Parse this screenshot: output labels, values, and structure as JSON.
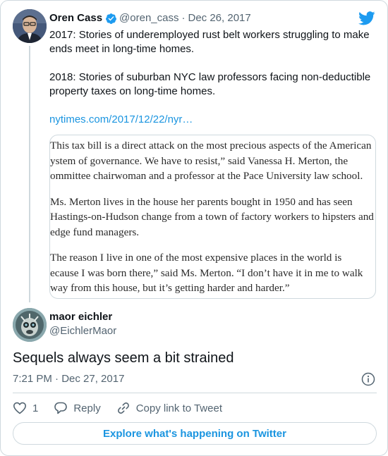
{
  "colors": {
    "link": "#1b95e0",
    "text": "#0f1419",
    "muted": "#536471",
    "border": "#cfd9de",
    "verified": "#1d9bf0"
  },
  "parent_tweet": {
    "author_name": "Oren Cass",
    "handle": "@oren_cass",
    "separator": "·",
    "date": "Dec 26, 2017",
    "paragraphs": [
      "2017: Stories of underemployed rust belt workers struggling to make ends meet in long-time homes.",
      "2018: Stories of suburban NYC law professors facing non-deductible property taxes on long-time homes."
    ],
    "link": "nytimes.com/2017/12/22/nyr…",
    "quote_image": {
      "paragraphs": [
        [
          "This tax bill is a direct attack on the most precious aspects of the American",
          "ystem of governance. We have to resist,” said Vanessa H. Merton, the",
          "ommittee chairwoman and a professor at the Pace University law school."
        ],
        [
          "Ms. Merton lives in the house her parents bought in 1950 and has seen",
          "Hastings-on-Hudson change from a town of factory workers to hipsters and",
          "edge fund managers."
        ],
        [
          "The reason I live in one of the most expensive places in the world is",
          "ecause I was born there,” said Ms. Merton. “I don’t have it in me to walk",
          "way from this house, but it’s getting harder and harder.”"
        ]
      ]
    }
  },
  "reply_tweet": {
    "author_name": "maor eichler",
    "handle": "@EichlerMaor",
    "text": "Sequels always seem a bit strained",
    "timestamp": "7:21 PM · Dec 27, 2017"
  },
  "actions": {
    "like_count": "1",
    "reply_label": "Reply",
    "copy_label": "Copy link to Tweet"
  },
  "explore_label": "Explore what's happening on Twitter",
  "icons": [
    "verified-icon",
    "twitter-bird-icon",
    "info-icon",
    "heart-icon",
    "reply-icon",
    "link-icon"
  ]
}
